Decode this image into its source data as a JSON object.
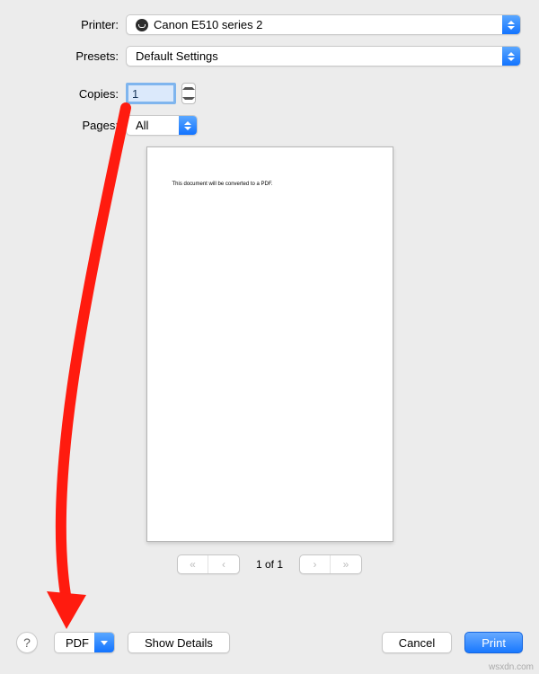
{
  "labels": {
    "printer": "Printer:",
    "presets": "Presets:",
    "copies": "Copies:",
    "pages": "Pages:"
  },
  "printer": {
    "value": "Canon E510 series 2"
  },
  "presets": {
    "value": "Default Settings"
  },
  "copies": {
    "value": "1"
  },
  "pages": {
    "value": "All"
  },
  "preview": {
    "text": "This document will be converted to a PDF."
  },
  "pager": {
    "text": "1 of 1"
  },
  "footer": {
    "pdf": "PDF",
    "show_details": "Show Details",
    "cancel": "Cancel",
    "print": "Print"
  },
  "watermark": "wsxdn.com"
}
